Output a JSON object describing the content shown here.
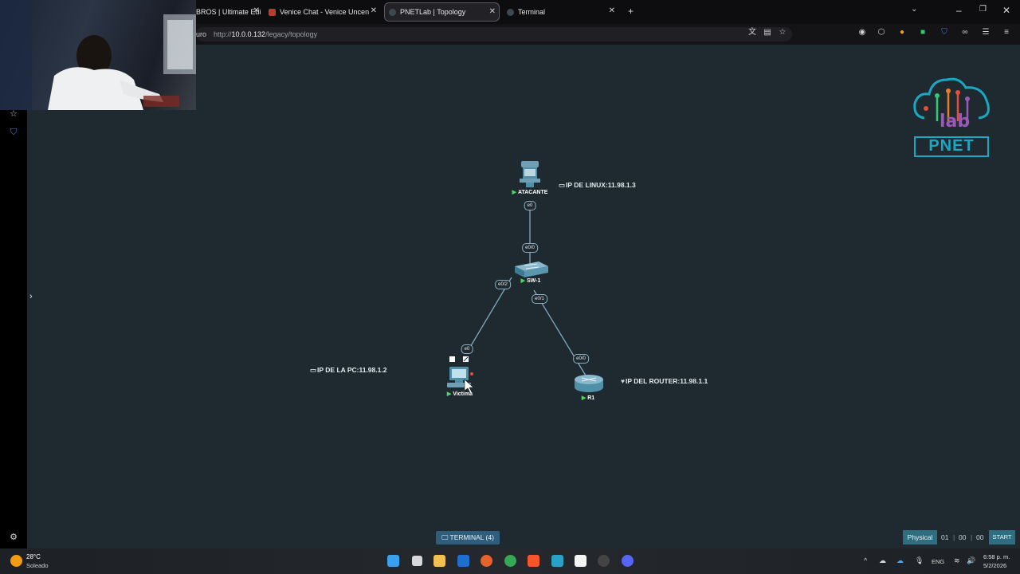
{
  "browser": {
    "tabs": [
      {
        "title": "BROS | Ultimate Edi",
        "close": "✕"
      },
      {
        "title": "Venice Chat - Venice Uncensored",
        "close": "✕"
      },
      {
        "title": "PNETLab | Topology",
        "close": "✕"
      },
      {
        "title": "Terminal",
        "close": "✕"
      }
    ],
    "new_tab": "+",
    "security_label": "uro",
    "url_prefix": "http://",
    "url_host": "10.0.0.132",
    "url_path": "/legacy/topology"
  },
  "logo": {
    "text": "PNET",
    "sub": "lab"
  },
  "nodes": {
    "atacante": {
      "label": "ATACANTE"
    },
    "switch": {
      "label": "SW-1"
    },
    "victima": {
      "label": "Victima"
    },
    "router": {
      "label": "R1"
    }
  },
  "interfaces": {
    "atacante_e0": "e0",
    "sw_e00": "e0/0",
    "sw_e02": "e0/2",
    "sw_e01": "e0/1",
    "victima_e0": "e0",
    "router_e00": "e0/0"
  },
  "notes": {
    "linux": "IP DE LINUX:11.98.1.3",
    "pc": "IP DE LA PC:11.98.1.2",
    "router": "IP DEL ROUTER:11.98.1.1"
  },
  "controls": {
    "terminal": "TERMINAL (4)",
    "physical": "Physical",
    "timer_h": "01",
    "timer_m": "00",
    "timer_s": "00",
    "start": "START"
  },
  "taskbar": {
    "temperature": "28°C",
    "condition": "Soleado",
    "lang": "ENG",
    "time": "6:58 p. m.",
    "date": "5/2/2026"
  },
  "colors": {
    "canvas_bg": "#1e2a30",
    "link": "#7fa9bf",
    "node_blue": "#4f8fa8",
    "run_green": "#4cd964",
    "button_blue": "#2e6e80"
  }
}
